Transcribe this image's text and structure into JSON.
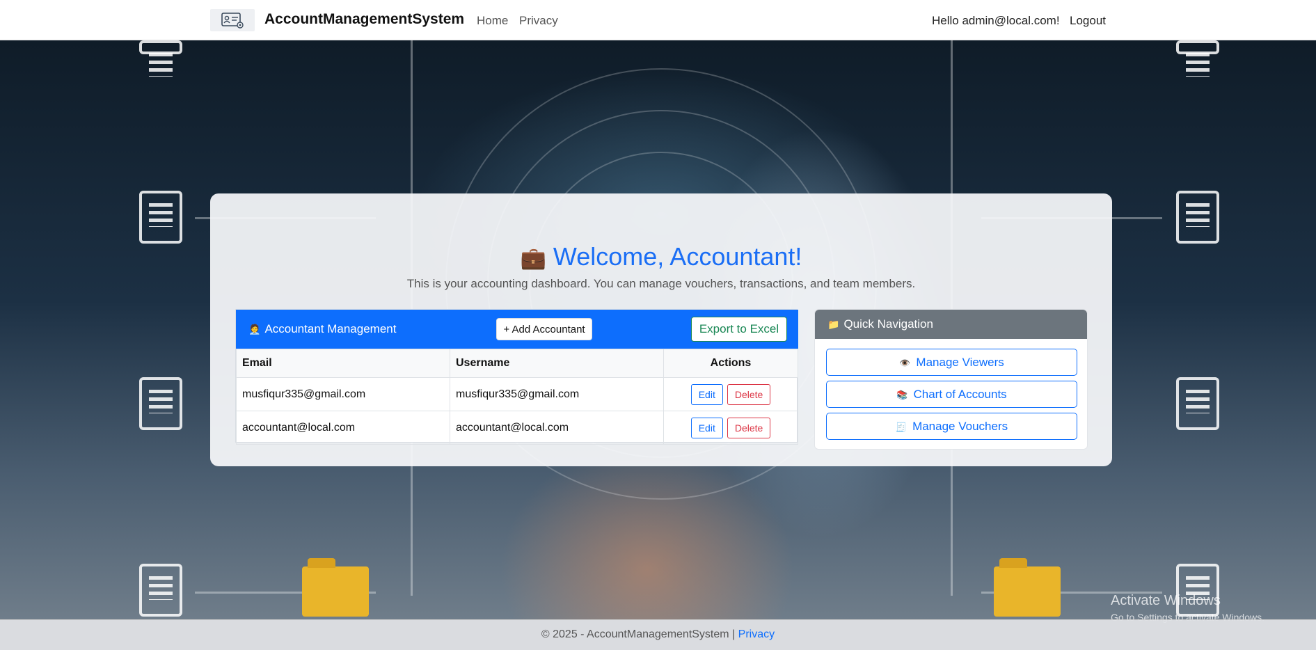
{
  "navbar": {
    "brand": "AccountManagementSystem",
    "links": [
      "Home",
      "Privacy"
    ],
    "greeting": "Hello admin@local.com!",
    "logout": "Logout"
  },
  "hero": {
    "emoji": "💼",
    "title": "Welcome, Accountant!",
    "subtitle": "This is your accounting dashboard. You can manage vouchers, transactions, and team members."
  },
  "accountants": {
    "title_emoji": "🧑‍💼",
    "title": "Accountant Management",
    "add_label": "+ Add Accountant",
    "export_label": "Export to Excel",
    "columns": [
      "Email",
      "Username",
      "Actions"
    ],
    "rows": [
      {
        "email": "musfiqur335@gmail.com",
        "username": "musfiqur335@gmail.com"
      },
      {
        "email": "accountant@local.com",
        "username": "accountant@local.com"
      }
    ],
    "edit_label": "Edit",
    "delete_label": "Delete"
  },
  "quick_nav": {
    "title_emoji": "📁",
    "title": "Quick Navigation",
    "items": [
      {
        "emoji": "👁️",
        "label": "Manage Viewers"
      },
      {
        "emoji": "📚",
        "label": "Chart of Accounts"
      },
      {
        "emoji": "🧾",
        "label": "Manage Vouchers"
      }
    ]
  },
  "footer": {
    "text": "© 2025 - AccountManagementSystem |",
    "privacy": "Privacy"
  },
  "watermark": {
    "line1": "Activate Windows",
    "line2": "Go to Settings to activate Windows."
  },
  "colors": {
    "primary": "#0d6efd",
    "success": "#198754",
    "danger": "#dc3545",
    "secondary": "#6c757d"
  }
}
